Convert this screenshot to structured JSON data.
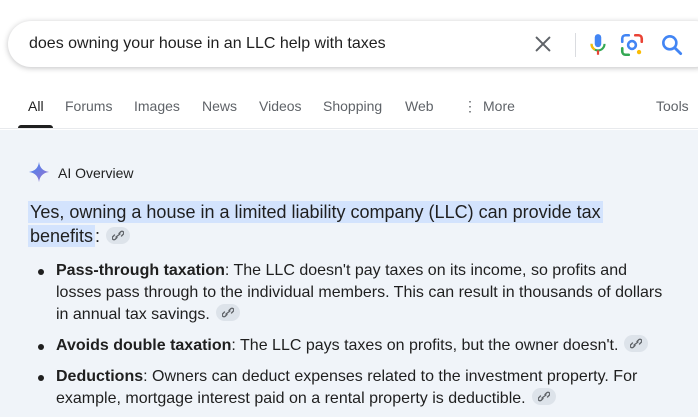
{
  "search": {
    "query": "does owning your house in an LLC help with taxes",
    "icons": [
      "close-icon",
      "mic-icon",
      "lens-icon",
      "search-icon"
    ]
  },
  "tabs": [
    {
      "label": "All"
    },
    {
      "label": "Forums"
    },
    {
      "label": "Images"
    },
    {
      "label": "News"
    },
    {
      "label": "Videos"
    },
    {
      "label": "Shopping"
    },
    {
      "label": "Web"
    },
    {
      "label": "More"
    }
  ],
  "tools_label": "Tools",
  "ai_overview": {
    "title": "AI Overview",
    "headline_part1": "Yes, owning a house in a limited liability company (LLC) can provide tax",
    "headline_part2": "benefits",
    "headline_suffix": ":",
    "bullets": [
      {
        "term": "Pass-through taxation",
        "text": ": The LLC doesn't pay taxes on its income, so profits and losses pass through to the individual members. This can result in thousands of dollars in annual tax savings."
      },
      {
        "term": "Avoids double taxation",
        "text": ": The LLC pays taxes on profits, but the owner doesn't."
      },
      {
        "term": "Deductions",
        "text": ": Owners can deduct expenses related to the investment property. For example, mortgage interest paid on a rental property is deductible."
      }
    ]
  },
  "colors": {
    "highlight": "#d3e3fd",
    "panel_bg": "#f0f4f9",
    "google_blue": "#4285f4",
    "google_red": "#ea4335",
    "google_yellow": "#fbbc04",
    "google_green": "#34a853"
  }
}
